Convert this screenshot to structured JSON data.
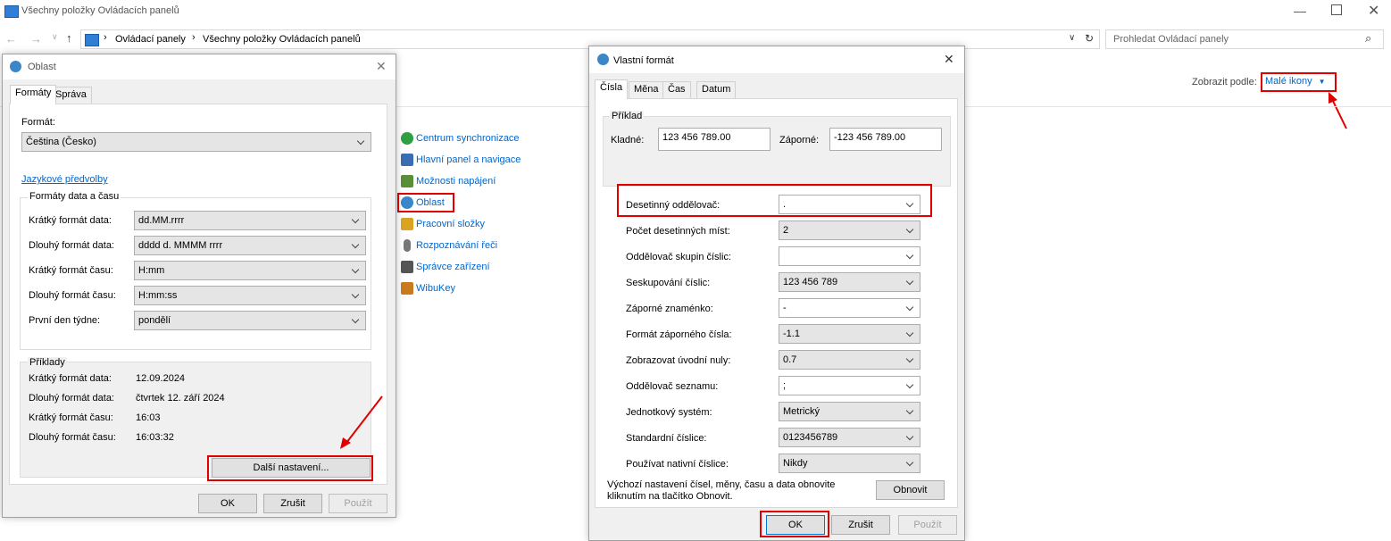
{
  "explorer": {
    "title": "Všechny položky Ovládacích panelů",
    "breadcrumb": [
      "Ovládací panely",
      "Všechny položky Ovládacích panelů"
    ],
    "search_placeholder": "Prohledat Ovládací panely",
    "view_label": "Zobrazit podle:",
    "view_value": "Malé ikony",
    "items": [
      {
        "label": "Centrum synchronizace",
        "icon": "sync-icon",
        "color": "#2ea043"
      },
      {
        "label": "Hlavní panel a navigace",
        "icon": "taskbar-icon",
        "color": "#3b6db3"
      },
      {
        "label": "Možnosti napájení",
        "icon": "power-icon",
        "color": "#5a8f3a"
      },
      {
        "label": "Oblast",
        "icon": "globe-clock-icon",
        "color": "#3a86c8"
      },
      {
        "label": "Pracovní složky",
        "icon": "folder-icon",
        "color": "#d9a520"
      },
      {
        "label": "Rozpoznávání řeči",
        "icon": "microphone-icon",
        "color": "#777777"
      },
      {
        "label": "Správce zařízení",
        "icon": "device-manager-icon",
        "color": "#555555"
      },
      {
        "label": "WibuKey",
        "icon": "wibukey-icon",
        "color": "#c97a1c"
      }
    ]
  },
  "oblast": {
    "title": "Oblast",
    "tabs": [
      "Formáty",
      "Správa"
    ],
    "format_label": "Formát:",
    "format_value": "Čeština (Česko)",
    "lang_link": "Jazykové předvolby",
    "datetime_group": "Formáty data a času",
    "rows": [
      {
        "label": "Krátký formát data:",
        "value": "dd.MM.rrrr"
      },
      {
        "label": "Dlouhý formát data:",
        "value": "dddd d. MMMM rrrr"
      },
      {
        "label": "Krátký formát času:",
        "value": "H:mm"
      },
      {
        "label": "Dlouhý formát času:",
        "value": "H:mm:ss"
      },
      {
        "label": "První den týdne:",
        "value": "pondělí"
      }
    ],
    "examples_group": "Příklady",
    "examples": [
      {
        "label": "Krátký formát data:",
        "value": "12.09.2024"
      },
      {
        "label": "Dlouhý formát data:",
        "value": "čtvrtek 12. září 2024"
      },
      {
        "label": "Krátký formát času:",
        "value": "16:03"
      },
      {
        "label": "Dlouhý formát času:",
        "value": "16:03:32"
      }
    ],
    "more_button": "Další nastavení...",
    "ok": "OK",
    "cancel": "Zrušit",
    "apply": "Použít"
  },
  "custom": {
    "title": "Vlastní formát",
    "tabs": [
      "Čísla",
      "Měna",
      "Čas",
      "Datum"
    ],
    "example_group": "Příklad",
    "positive_label": "Kladné:",
    "positive_value": "123 456 789.00",
    "negative_label": "Záporné:",
    "negative_value": "-123 456 789.00",
    "rows": [
      {
        "label": "Desetinný oddělovač:",
        "value": "."
      },
      {
        "label": "Počet desetinných míst:",
        "value": "2"
      },
      {
        "label": "Oddělovač skupin číslic:",
        "value": ""
      },
      {
        "label": "Seskupování číslic:",
        "value": "123 456 789"
      },
      {
        "label": "Záporné znaménko:",
        "value": "-"
      },
      {
        "label": "Formát záporného čísla:",
        "value": "-1.1"
      },
      {
        "label": "Zobrazovat úvodní nuly:",
        "value": "0.7"
      },
      {
        "label": "Oddělovač seznamu:",
        "value": ";"
      },
      {
        "label": "Jednotkový systém:",
        "value": "Metrický"
      },
      {
        "label": "Standardní číslice:",
        "value": "0123456789"
      },
      {
        "label": "Používat nativní číslice:",
        "value": "Nikdy"
      }
    ],
    "reset_text": "Výchozí nastavení čísel, měny, času a data obnovite kliknutím na tlačítko Obnovit.",
    "reset_button": "Obnovit",
    "ok": "OK",
    "cancel": "Zrušit",
    "apply": "Použít"
  }
}
